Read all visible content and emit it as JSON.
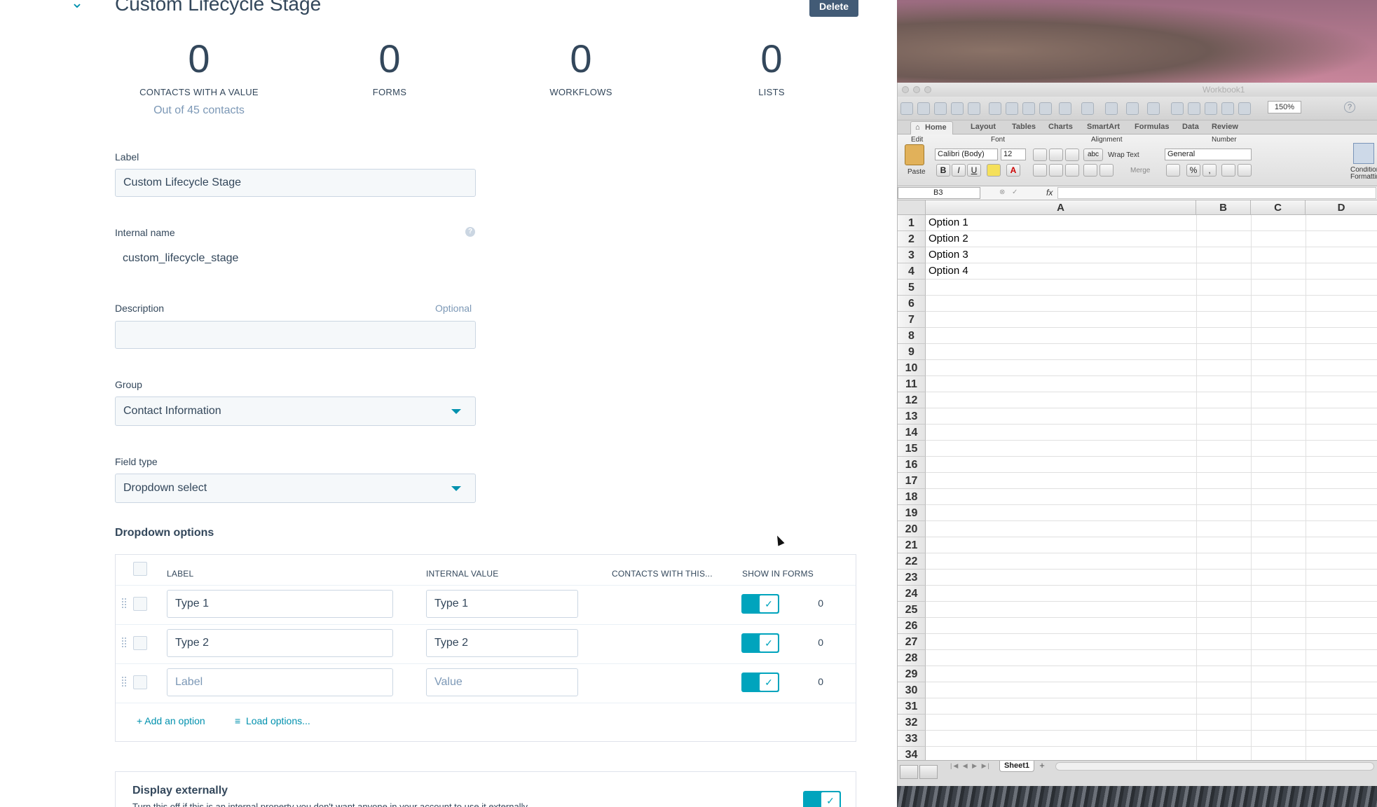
{
  "page": {
    "title": "Custom Lifecycle Stage",
    "delete_label": "Delete"
  },
  "stats": [
    {
      "value": "0",
      "label": "CONTACTS WITH A VALUE",
      "sub": "Out of 45 contacts"
    },
    {
      "value": "0",
      "label": "FORMS"
    },
    {
      "value": "0",
      "label": "WORKFLOWS"
    },
    {
      "value": "0",
      "label": "LISTS"
    }
  ],
  "form": {
    "label": {
      "label": "Label",
      "value": "Custom Lifecycle Stage"
    },
    "internal_name": {
      "label": "Internal name",
      "value": "custom_lifecycle_stage",
      "help_icon": "?"
    },
    "description": {
      "label": "Description",
      "optional": "Optional",
      "value": ""
    },
    "group": {
      "label": "Group",
      "value": "Contact Information"
    },
    "field_type": {
      "label": "Field type",
      "value": "Dropdown select"
    }
  },
  "dropdown_options": {
    "title": "Dropdown options",
    "headers": [
      "LABEL",
      "INTERNAL VALUE",
      "CONTACTS WITH THIS...",
      "SHOW IN FORMS"
    ],
    "rows": [
      {
        "label": "Type 1",
        "value": "Type 1",
        "count": "0",
        "show_in_forms": true
      },
      {
        "label": "Type 2",
        "value": "Type 2",
        "count": "0",
        "show_in_forms": true
      },
      {
        "label_placeholder": "Label",
        "value_placeholder": "Value",
        "count": "0",
        "show_in_forms": true
      }
    ],
    "add_option": "Add an option",
    "load_options": "Load options..."
  },
  "display_externally": {
    "title": "Display externally",
    "description": "Turn this off if this is an internal property you don't want anyone in your account to use it externally.",
    "enabled": true
  },
  "excel": {
    "window_title": "Workbook1",
    "zoom": "150%",
    "tabs": [
      "Home",
      "Layout",
      "Tables",
      "Charts",
      "SmartArt",
      "Formulas",
      "Data",
      "Review"
    ],
    "groups": [
      "Edit",
      "Font",
      "Alignment",
      "Number"
    ],
    "paste_label": "Paste",
    "font_name": "Calibri (Body)",
    "font_size": "12",
    "wrap_text": "Wrap Text",
    "merge": "Merge",
    "number_format": "General",
    "conditional_formatting": "Conditional Formatting",
    "name_box": "B3",
    "fx": "fx",
    "columns": [
      "A",
      "B",
      "C",
      "D"
    ],
    "cells": {
      "A1": "Option 1",
      "A2": "Option 2",
      "A3": "Option 3",
      "A4": "Option 4"
    },
    "sheet_tab": "Sheet1",
    "bold": "B",
    "italic": "I",
    "underline": "U",
    "abc": "abc",
    "percent": "%",
    "comma": ","
  },
  "colors": {
    "accent": "#0091ae",
    "toggle": "#00a4bd",
    "text": "#33475b",
    "muted": "#7c98b6",
    "delete_button": "#425b76"
  }
}
